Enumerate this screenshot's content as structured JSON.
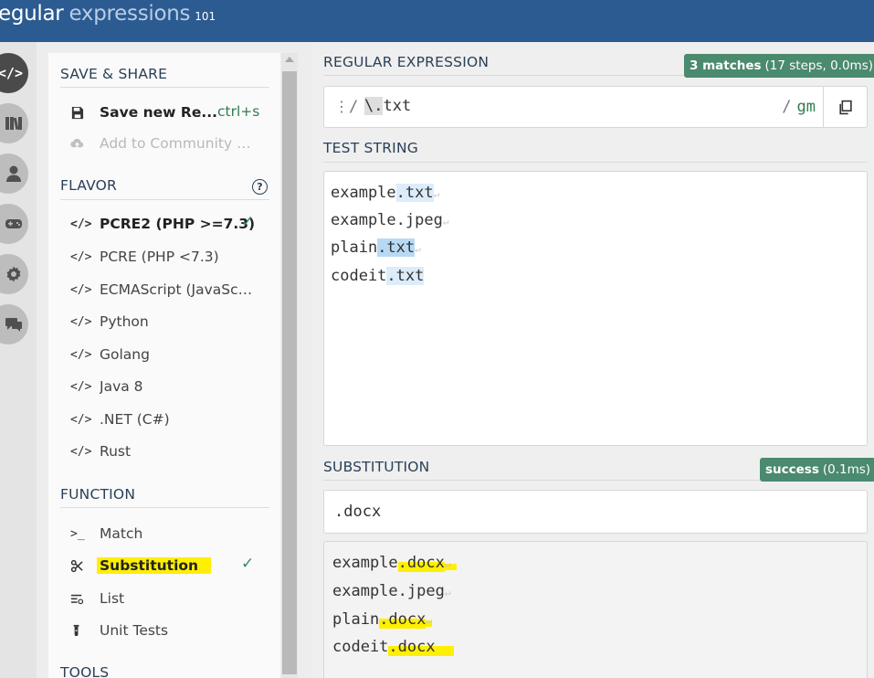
{
  "header": {
    "logo_part1": "egular",
    "logo_part2": "expressions",
    "logo_part3": "101"
  },
  "iconbar": [
    "code-icon",
    "library-icon",
    "user-icon",
    "gamepad-icon",
    "gear-icon",
    "chat-icon"
  ],
  "sidebar": {
    "save_share": {
      "title": "SAVE & SHARE",
      "save_label": "Save new Re...",
      "save_shortcut": "ctrl+s",
      "community_label": "Add to Community L..."
    },
    "flavor": {
      "title": "FLAVOR",
      "help": "?",
      "items": [
        {
          "label": "PCRE2 (PHP >=7.3)",
          "selected": true
        },
        {
          "label": "PCRE (PHP <7.3)"
        },
        {
          "label": "ECMAScript (JavaScri..."
        },
        {
          "label": "Python"
        },
        {
          "label": "Golang"
        },
        {
          "label": "Java 8"
        },
        {
          "label": ".NET (C#)"
        },
        {
          "label": "Rust"
        }
      ],
      "icon_text": "</>"
    },
    "function": {
      "title": "FUNCTION",
      "items": [
        {
          "label": "Match",
          "icon": ">_"
        },
        {
          "label": "Substitution",
          "selected": true
        },
        {
          "label": "List"
        },
        {
          "label": "Unit Tests"
        }
      ]
    },
    "tools": {
      "title": "TOOLS"
    }
  },
  "regex": {
    "title": "REGULAR EXPRESSION",
    "badge_strong": "3 matches",
    "badge_rest": "(17 steps, 0.0ms)",
    "delimiter_left": "/",
    "escape": "\\.",
    "rest": "txt",
    "delimiter_right": "/",
    "flags": "gm"
  },
  "test_string": {
    "title": "TEST STRING",
    "lines": [
      {
        "pre": "example",
        "match": ".txt"
      },
      {
        "pre": "example.jpeg",
        "match": ""
      },
      {
        "pre": "plain",
        "match": ".txt"
      },
      {
        "pre": "codeit",
        "match": ".txt"
      }
    ]
  },
  "substitution": {
    "title": "SUBSTITUTION",
    "badge_strong": "success",
    "badge_rest": "(0.1ms)",
    "value": ".docx",
    "result_lines": [
      {
        "pre": "example",
        "sub": ".docx"
      },
      {
        "pre": "example.jpeg",
        "sub": ""
      },
      {
        "pre": "plain",
        "sub": ".docx"
      },
      {
        "pre": "codeit",
        "sub": ".docx"
      }
    ]
  },
  "colors": {
    "header": "#2c5b91",
    "badge": "#4a8a6e",
    "match_light": "#dcecfb",
    "match_dark": "#b8d9f5",
    "highlight": "#ffef00"
  }
}
